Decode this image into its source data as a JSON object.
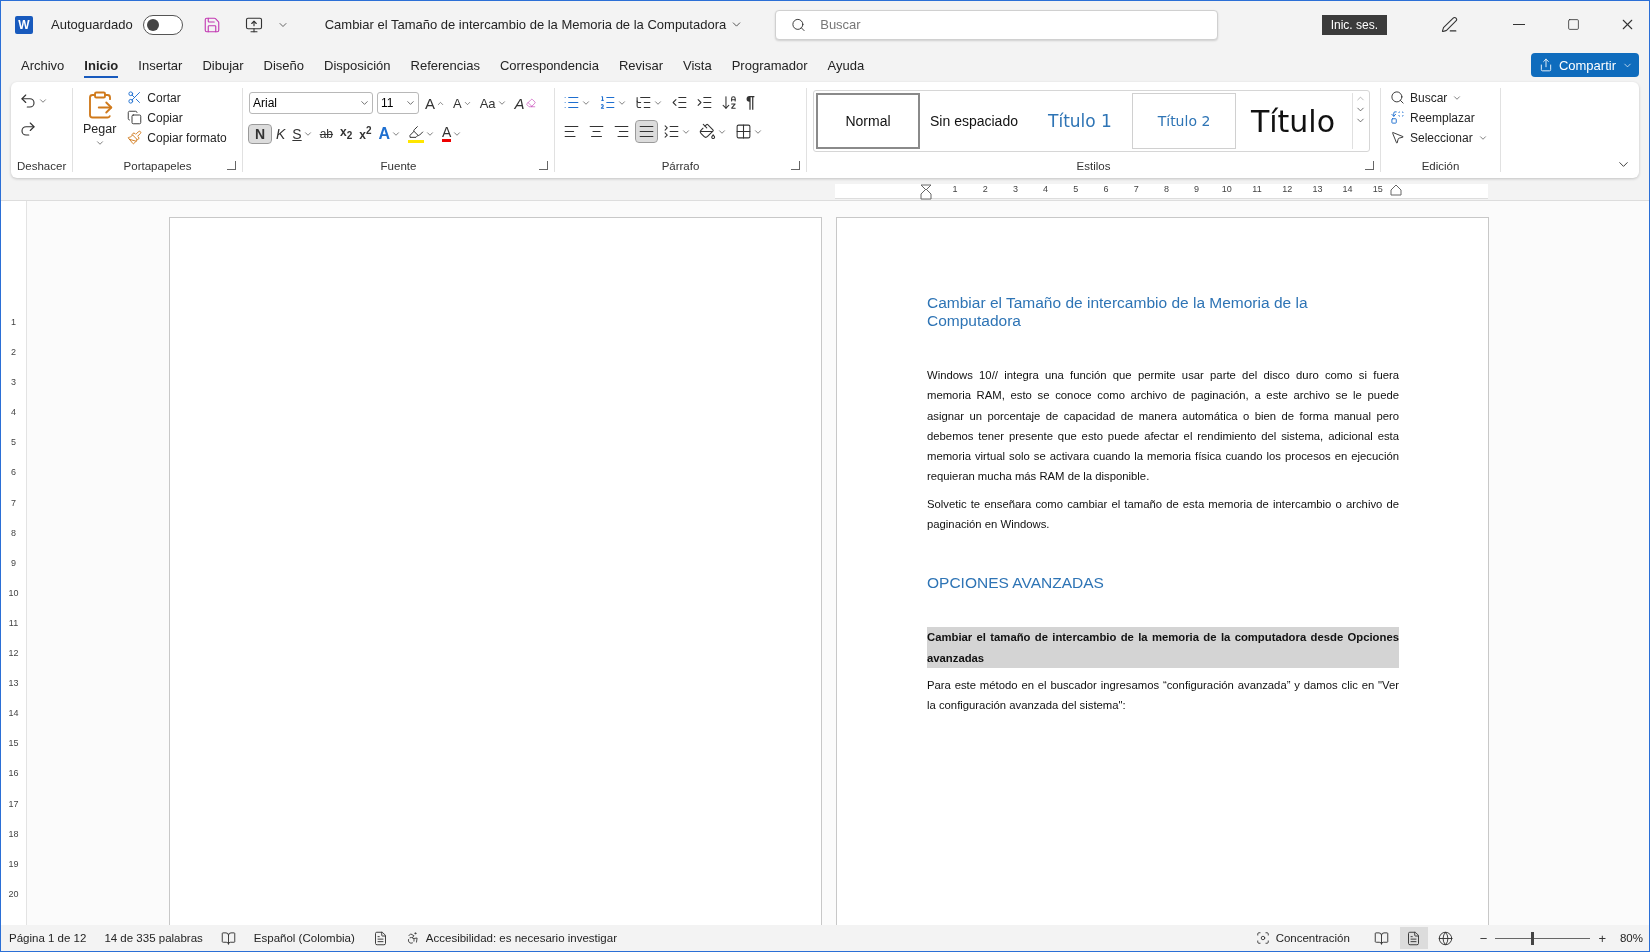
{
  "title_bar": {
    "app_icon": "W",
    "autosave_label": "Autoguardado",
    "autosave_on": false,
    "document_title": "Cambiar el Tamaño de intercambio de la Memoria de la Computadora",
    "search_placeholder": "Buscar",
    "sign_in": "Inic. ses."
  },
  "tabs": [
    {
      "label": "Archivo",
      "selected": false
    },
    {
      "label": "Inicio",
      "selected": true
    },
    {
      "label": "Insertar",
      "selected": false
    },
    {
      "label": "Dibujar",
      "selected": false
    },
    {
      "label": "Diseño",
      "selected": false
    },
    {
      "label": "Disposición",
      "selected": false
    },
    {
      "label": "Referencias",
      "selected": false
    },
    {
      "label": "Correspondencia",
      "selected": false
    },
    {
      "label": "Revisar",
      "selected": false
    },
    {
      "label": "Vista",
      "selected": false
    },
    {
      "label": "Programador",
      "selected": false
    },
    {
      "label": "Ayuda",
      "selected": false
    }
  ],
  "share_button": "Compartir",
  "ribbon": {
    "undo_group": "Deshacer",
    "clipboard": {
      "label": "Portapapeles",
      "paste": "Pegar",
      "cut": "Cortar",
      "copy": "Copiar",
      "format_painter": "Copiar formato"
    },
    "font": {
      "label": "Fuente",
      "font_name": "Arial",
      "font_size": "11",
      "row1": [
        {
          "kind": "grow",
          "label": "A"
        },
        {
          "kind": "shrink",
          "label": "A"
        },
        {
          "kind": "case",
          "label": "Aa"
        },
        {
          "kind": "clear",
          "label": "A"
        }
      ],
      "row2": [
        {
          "kind": "bold",
          "label": "N",
          "pressed": true
        },
        {
          "kind": "italic",
          "label": "K",
          "pressed": false
        },
        {
          "kind": "underline",
          "label": "S",
          "pressed": false
        },
        {
          "kind": "strike",
          "label": "ab",
          "pressed": false
        },
        {
          "kind": "subscript",
          "label": "x$_{2}$",
          "pressed": false
        },
        {
          "kind": "superscript",
          "label": "x$^{2}$",
          "pressed": false
        },
        {
          "kind": "effects",
          "label": "A",
          "pressed": false
        },
        {
          "kind": "highlight",
          "pressed": false
        },
        {
          "kind": "color",
          "label": "A",
          "pressed": false
        }
      ]
    },
    "paragraph": {
      "label": "Párrafo",
      "row1": [
        {
          "kind": "bullets",
          "pressed": false
        },
        {
          "kind": "numbering",
          "pressed": false
        },
        {
          "kind": "multilevel",
          "pressed": false
        },
        {
          "kind": "outdent",
          "pressed": false
        },
        {
          "kind": "indent",
          "pressed": false
        },
        {
          "kind": "sort",
          "pressed": false
        },
        {
          "kind": "pilcrow",
          "label": "¶",
          "pressed": false
        }
      ],
      "row2": [
        {
          "kind": "left",
          "pressed": false
        },
        {
          "kind": "center",
          "pressed": false
        },
        {
          "kind": "right",
          "pressed": false
        },
        {
          "kind": "justify",
          "pressed": true
        },
        {
          "kind": "spacing",
          "pressed": false
        },
        {
          "kind": "shading",
          "pressed": false
        },
        {
          "kind": "borders",
          "pressed": false
        }
      ]
    },
    "styles": {
      "label": "Estilos",
      "items": [
        {
          "label": "Normal",
          "kind": "normal",
          "selected": true,
          "hovered": false
        },
        {
          "label": "Sin espaciado",
          "kind": "plain",
          "selected": false,
          "hovered": false
        },
        {
          "label": "Título 1",
          "kind": "heading1",
          "selected": false,
          "hovered": false
        },
        {
          "label": "Título 2",
          "kind": "heading2",
          "selected": false,
          "hovered": true
        },
        {
          "label": "Título",
          "kind": "title",
          "selected": false,
          "hovered": false
        }
      ]
    },
    "editing": {
      "label": "Edición",
      "find": "Buscar",
      "replace": "Reemplazar",
      "select": "Seleccionar"
    }
  },
  "ruler": {
    "horizontal": [
      "1",
      "2",
      "3",
      "4",
      "5",
      "6",
      "7",
      "8",
      "9",
      "10",
      "11",
      "12",
      "13",
      "14",
      "15"
    ],
    "vertical": [
      "1",
      "2",
      "3",
      "4",
      "5",
      "6",
      "7",
      "8",
      "9",
      "10",
      "11",
      "12",
      "13",
      "14",
      "15",
      "16",
      "17",
      "18",
      "19",
      "20"
    ]
  },
  "document": {
    "paragraphs": [
      {
        "kind": "heading",
        "text": "Cambiar el Tamaño de intercambio de la Memoria de la Computadora",
        "selected": false
      },
      {
        "kind": "body",
        "text": "Windows 10// integra una función que permite usar parte del disco duro como si fuera memoria RAM, esto se conoce como archivo de paginación, a este archivo se le puede asignar un porcentaje de capacidad de manera automática o bien de forma manual pero debemos tener presente que esto puede afectar el rendimiento del sistema, adicional esta memoria virtual solo se activara cuando la memoria física cuando los procesos en ejecución requieran mucha más RAM de la disponible.",
        "selected": false
      },
      {
        "kind": "body",
        "text": "Solvetic te enseñara como cambiar el tamaño de esta memoria de intercambio o archivo de paginación en Windows.",
        "selected": false
      },
      {
        "kind": "heading",
        "text": "OPCIONES AVANZADAS",
        "selected": false
      },
      {
        "kind": "strong",
        "text": "Cambiar el tamaño de intercambio de la memoria de la computadora desde Opciones avanzadas",
        "selected": true
      },
      {
        "kind": "body",
        "text": "Para este método en el buscador ingresamos “configuración avanzada” y damos clic en \"Ver la configuración avanzada del sistema\":",
        "selected": false
      }
    ]
  },
  "status_bar": {
    "page": "Página 1 de 12",
    "words": "14 de 335 palabras",
    "language": "Español (Colombia)",
    "accessibility": "Accesibilidad: es necesario investigar",
    "focus": "Concentración",
    "views": [
      {
        "kind": "read",
        "selected": false
      },
      {
        "kind": "print",
        "selected": true
      },
      {
        "kind": "web",
        "selected": false
      }
    ],
    "zoom_out": "−",
    "zoom_in": "+",
    "zoom": {
      "level": 0.39
    },
    "zoom_text": "80%"
  }
}
